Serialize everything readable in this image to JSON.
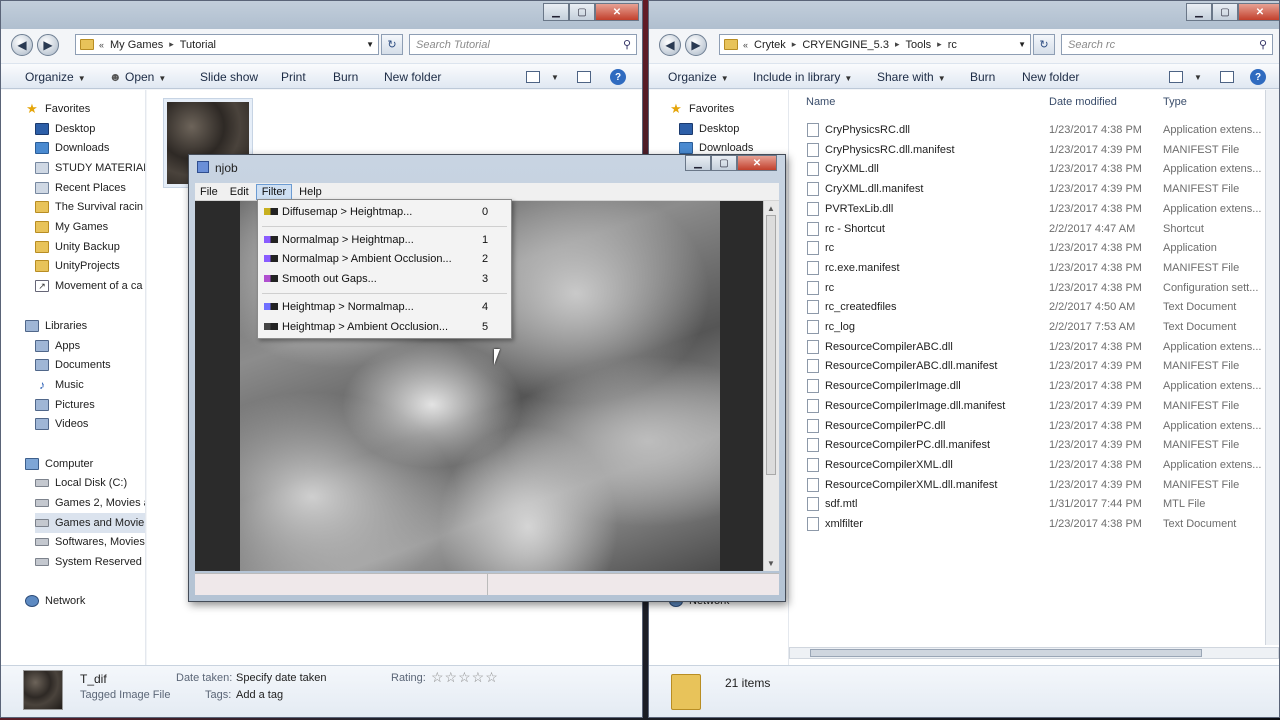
{
  "left_window": {
    "breadcrumb": [
      "My Games",
      "Tutorial"
    ],
    "search_placeholder": "Search Tutorial",
    "toolbar": {
      "organize": "Organize",
      "open": "Open",
      "slideshow": "Slide show",
      "print": "Print",
      "burn": "Burn",
      "new_folder": "New folder"
    },
    "tree": {
      "favorites": "Favorites",
      "favorites_items": [
        "Desktop",
        "Downloads",
        "STUDY MATERIAL",
        "Recent Places",
        "The Survival racin",
        "My Games",
        "Unity Backup",
        "UnityProjects",
        "Movement of a ca"
      ],
      "libraries": "Libraries",
      "libraries_items": [
        "Apps",
        "Documents",
        "Music",
        "Pictures",
        "Videos"
      ],
      "computer": "Computer",
      "computer_items": [
        "Local Disk (C:)",
        "Games 2, Movies a",
        "Games and Movie",
        "Softwares, Movies",
        "System Reserved ("
      ],
      "network": "Network"
    },
    "status": {
      "filename": "T_dif",
      "filetype": "Tagged Image File",
      "date_label": "Date taken:",
      "date_value": "Specify date taken",
      "tags_label": "Tags:",
      "tags_value": "Add a tag",
      "rating_label": "Rating:",
      "stars": "☆☆☆☆☆"
    }
  },
  "right_window": {
    "breadcrumb": [
      "Crytek",
      "CRYENGINE_5.3",
      "Tools",
      "rc"
    ],
    "search_placeholder": "Search rc",
    "toolbar": {
      "organize": "Organize",
      "include": "Include in library",
      "share": "Share with",
      "burn": "Burn",
      "new_folder": "New folder"
    },
    "tree": {
      "favorites": "Favorites",
      "desktop": "Desktop",
      "downloads": "Downloads",
      "network": "Network"
    },
    "columns": {
      "name": "Name",
      "date": "Date modified",
      "type": "Type"
    },
    "files": [
      {
        "name": "CryPhysicsRC.dll",
        "date": "1/23/2017 4:38 PM",
        "type": "Application extens..."
      },
      {
        "name": "CryPhysicsRC.dll.manifest",
        "date": "1/23/2017 4:39 PM",
        "type": "MANIFEST File"
      },
      {
        "name": "CryXML.dll",
        "date": "1/23/2017 4:38 PM",
        "type": "Application extens..."
      },
      {
        "name": "CryXML.dll.manifest",
        "date": "1/23/2017 4:39 PM",
        "type": "MANIFEST File"
      },
      {
        "name": "PVRTexLib.dll",
        "date": "1/23/2017 4:38 PM",
        "type": "Application extens..."
      },
      {
        "name": "rc - Shortcut",
        "date": "2/2/2017 4:47 AM",
        "type": "Shortcut"
      },
      {
        "name": "rc",
        "date": "1/23/2017 4:38 PM",
        "type": "Application"
      },
      {
        "name": "rc.exe.manifest",
        "date": "1/23/2017 4:38 PM",
        "type": "MANIFEST File"
      },
      {
        "name": "rc",
        "date": "1/23/2017 4:38 PM",
        "type": "Configuration sett..."
      },
      {
        "name": "rc_createdfiles",
        "date": "2/2/2017 4:50 AM",
        "type": "Text Document"
      },
      {
        "name": "rc_log",
        "date": "2/2/2017 7:53 AM",
        "type": "Text Document"
      },
      {
        "name": "ResourceCompilerABC.dll",
        "date": "1/23/2017 4:38 PM",
        "type": "Application extens..."
      },
      {
        "name": "ResourceCompilerABC.dll.manifest",
        "date": "1/23/2017 4:39 PM",
        "type": "MANIFEST File"
      },
      {
        "name": "ResourceCompilerImage.dll",
        "date": "1/23/2017 4:38 PM",
        "type": "Application extens..."
      },
      {
        "name": "ResourceCompilerImage.dll.manifest",
        "date": "1/23/2017 4:39 PM",
        "type": "MANIFEST File"
      },
      {
        "name": "ResourceCompilerPC.dll",
        "date": "1/23/2017 4:38 PM",
        "type": "Application extens..."
      },
      {
        "name": "ResourceCompilerPC.dll.manifest",
        "date": "1/23/2017 4:39 PM",
        "type": "MANIFEST File"
      },
      {
        "name": "ResourceCompilerXML.dll",
        "date": "1/23/2017 4:38 PM",
        "type": "Application extens..."
      },
      {
        "name": "ResourceCompilerXML.dll.manifest",
        "date": "1/23/2017 4:39 PM",
        "type": "MANIFEST File"
      },
      {
        "name": "sdf.mtl",
        "date": "1/31/2017 7:44 PM",
        "type": "MTL File"
      },
      {
        "name": "xmlfilter",
        "date": "1/23/2017 4:38 PM",
        "type": "Text Document"
      }
    ],
    "status": {
      "count": "21 items"
    }
  },
  "njob": {
    "title": "njob",
    "menus": [
      "File",
      "Edit",
      "Filter",
      "Help"
    ],
    "filter_menu": [
      {
        "label": "Diffusemap > Heightmap...",
        "key": "0",
        "icon_color": "#c8b020"
      },
      {
        "label": "Normalmap > Heightmap...",
        "key": "1",
        "icon_color": "#8a5cff"
      },
      {
        "label": "Normalmap > Ambient Occlusion...",
        "key": "2",
        "icon_color": "#8a5cff"
      },
      {
        "label": "Smooth out Gaps...",
        "key": "3",
        "icon_color": "#b050d0"
      },
      {
        "label": "Heightmap > Normalmap...",
        "key": "4",
        "icon_color": "#7070ff"
      },
      {
        "label": "Heightmap > Ambient Occlusion...",
        "key": "5",
        "icon_color": "#444444"
      }
    ]
  }
}
